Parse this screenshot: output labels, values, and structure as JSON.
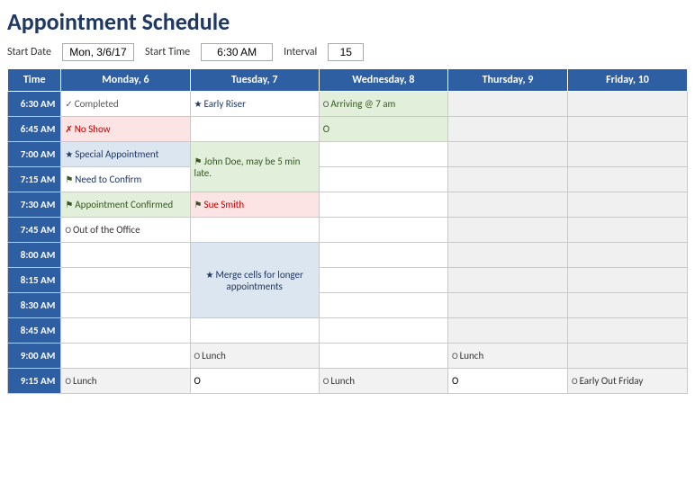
{
  "title": "Appointment Schedule",
  "controls": {
    "start_date_label": "Start Date",
    "start_date_value": "Mon, 3/6/17",
    "start_time_label": "Start Time",
    "start_time_value": "6:30 AM",
    "interval_label": "Interval",
    "interval_value": "15"
  },
  "headers": {
    "time": "Time",
    "days": [
      "Monday, 6",
      "Tuesday, 7",
      "Wednesday, 8",
      "Thursday, 9",
      "Friday, 10"
    ]
  },
  "rows": [
    {
      "time": "6:30 AM",
      "monday": {
        "text": "Completed",
        "icon": "✓",
        "style": "completed"
      },
      "tuesday": {
        "text": "Early Riser",
        "icon": "★",
        "style": "early-riser"
      },
      "wednesday": {
        "text": "Arriving @ 7 am",
        "icon": "O",
        "style": "arriving"
      },
      "thursday": {
        "text": "",
        "style": "empty"
      },
      "friday": {
        "text": "",
        "style": "empty"
      }
    },
    {
      "time": "6:45 AM",
      "monday": {
        "text": "No Show",
        "icon": "✗",
        "style": "noshow"
      },
      "tuesday": {
        "text": "",
        "style": "white"
      },
      "wednesday": {
        "text": "O",
        "icon": "",
        "style": "arriving-o"
      },
      "thursday": {
        "text": "",
        "style": "empty"
      },
      "friday": {
        "text": "",
        "style": "empty"
      }
    },
    {
      "time": "7:00 AM",
      "monday": {
        "text": "Special Appointment",
        "icon": "★",
        "style": "special"
      },
      "tuesday": {
        "text": "John Doe, may be 5 min late.",
        "icon": "⚑",
        "style": "john-doe",
        "rowspan": 2
      },
      "wednesday": {
        "text": "",
        "style": "white"
      },
      "thursday": {
        "text": "",
        "style": "empty"
      },
      "friday": {
        "text": "",
        "style": "empty"
      }
    },
    {
      "time": "7:15 AM",
      "monday": {
        "text": "Need to Confirm",
        "icon": "⚑",
        "style": "need-confirm"
      },
      "tuesday": null,
      "wednesday": {
        "text": "",
        "style": "white"
      },
      "thursday": {
        "text": "",
        "style": "empty"
      },
      "friday": {
        "text": "",
        "style": "empty"
      }
    },
    {
      "time": "7:30 AM",
      "monday": {
        "text": "Appointment Confirmed",
        "icon": "⚑",
        "style": "appt-confirmed"
      },
      "tuesday": {
        "text": "Sue Smith",
        "icon": "⚑",
        "style": "sue-smith"
      },
      "wednesday": {
        "text": "",
        "style": "white"
      },
      "thursday": {
        "text": "",
        "style": "empty"
      },
      "friday": {
        "text": "",
        "style": "empty"
      }
    },
    {
      "time": "7:45 AM",
      "monday": {
        "text": "Out of the Office",
        "icon": "O",
        "style": "out-office"
      },
      "tuesday": {
        "text": "",
        "style": "white"
      },
      "wednesday": {
        "text": "",
        "style": "white"
      },
      "thursday": {
        "text": "",
        "style": "empty"
      },
      "friday": {
        "text": "",
        "style": "empty"
      }
    },
    {
      "time": "8:00 AM",
      "monday": {
        "text": "",
        "style": "white"
      },
      "tuesday": {
        "text": "Merge cells for longer appointments",
        "icon": "★",
        "style": "merge",
        "rowspan": 3
      },
      "wednesday": {
        "text": "",
        "style": "white"
      },
      "thursday": {
        "text": "",
        "style": "empty"
      },
      "friday": {
        "text": "",
        "style": "empty"
      }
    },
    {
      "time": "8:15 AM",
      "monday": {
        "text": "",
        "style": "white"
      },
      "tuesday": null,
      "wednesday": {
        "text": "",
        "style": "white"
      },
      "thursday": {
        "text": "",
        "style": "empty"
      },
      "friday": {
        "text": "",
        "style": "empty"
      }
    },
    {
      "time": "8:30 AM",
      "monday": {
        "text": "",
        "style": "white"
      },
      "tuesday": null,
      "wednesday": {
        "text": "",
        "style": "white"
      },
      "thursday": {
        "text": "",
        "style": "empty"
      },
      "friday": {
        "text": "",
        "style": "empty"
      }
    },
    {
      "time": "8:45 AM",
      "monday": {
        "text": "",
        "style": "white"
      },
      "tuesday": {
        "text": "",
        "style": "white"
      },
      "wednesday": {
        "text": "",
        "style": "white"
      },
      "thursday": {
        "text": "",
        "style": "empty"
      },
      "friday": {
        "text": "",
        "style": "empty"
      }
    },
    {
      "time": "9:00 AM",
      "monday": {
        "text": "",
        "style": "white"
      },
      "tuesday": {
        "text": "Lunch",
        "icon": "O",
        "style": "lunch"
      },
      "wednesday": {
        "text": "",
        "style": "white"
      },
      "thursday": {
        "text": "Lunch",
        "icon": "O",
        "style": "lunch"
      },
      "friday": {
        "text": "",
        "style": "empty"
      }
    },
    {
      "time": "9:15 AM",
      "monday": {
        "text": "Lunch",
        "icon": "O",
        "style": "lunch"
      },
      "tuesday": {
        "text": "O",
        "icon": "",
        "style": "white"
      },
      "wednesday": {
        "text": "Lunch",
        "icon": "O",
        "style": "lunch"
      },
      "thursday": {
        "text": "O",
        "icon": "",
        "style": "white"
      },
      "friday": {
        "text": "Early Out Friday",
        "icon": "O",
        "style": "lunch"
      }
    }
  ]
}
